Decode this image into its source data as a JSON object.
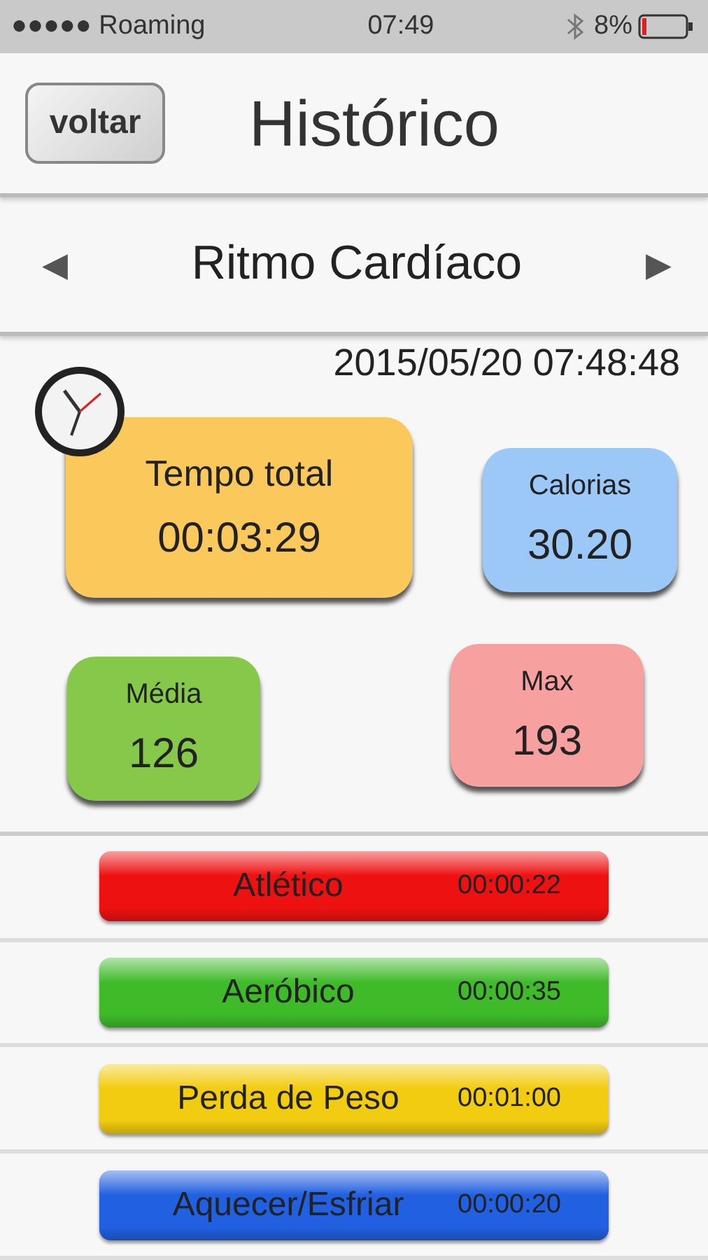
{
  "status_bar": {
    "carrier": "●●●●● Roaming",
    "time": "07:49",
    "battery": "8%"
  },
  "header": {
    "back_button": "voltar",
    "title": "Histórico"
  },
  "selector": {
    "prev": "◀",
    "label": "Ritmo Cardíaco",
    "next": "▶"
  },
  "date": "2015/05/20 07:48:48",
  "stats": [
    {
      "label": "Tempo total",
      "value": "00:03:29",
      "color": "#fbc85c"
    },
    {
      "label": "Calorias",
      "value": "30.20",
      "color": "#9cc8f7"
    },
    {
      "label": "Média",
      "value": "126",
      "color": "#86c94a"
    },
    {
      "label": "Max",
      "value": "193",
      "color": "#f7a0a0"
    }
  ],
  "zones": [
    {
      "name": "Atlético",
      "time": "00:00:22",
      "color": "#ee1111"
    },
    {
      "name": "Aeróbico",
      "time": "00:00:35",
      "color": "#3fbb2a"
    },
    {
      "name": "Perda de Peso",
      "time": "00:01:00",
      "color": "#f2cc10"
    },
    {
      "name": "Aquecer/Esfriar",
      "time": "00:00:20",
      "color": "#2160e0"
    }
  ]
}
